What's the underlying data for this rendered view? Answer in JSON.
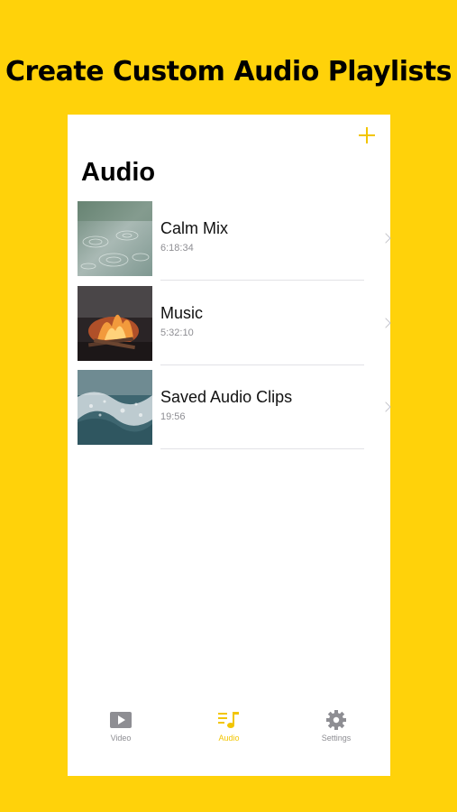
{
  "headline": "Create Custom Audio Playlists",
  "screen": {
    "title": "Audio",
    "add_icon": "plus-icon",
    "playlists": [
      {
        "title": "Calm Mix",
        "duration": "6:18:34",
        "thumbnail": "rain-water"
      },
      {
        "title": "Music",
        "duration": "5:32:10",
        "thumbnail": "campfire"
      },
      {
        "title": "Saved Audio Clips",
        "duration": "19:56",
        "thumbnail": "ocean-waves"
      }
    ]
  },
  "tabbar": {
    "active": "Audio",
    "tabs": [
      {
        "label": "Video",
        "icon": "play-icon"
      },
      {
        "label": "Audio",
        "icon": "music-list-icon"
      },
      {
        "label": "Settings",
        "icon": "gear-icon"
      }
    ]
  },
  "colors": {
    "background": "#FFD20A",
    "accent": "#F2C500",
    "inactive": "#8e8e93"
  }
}
